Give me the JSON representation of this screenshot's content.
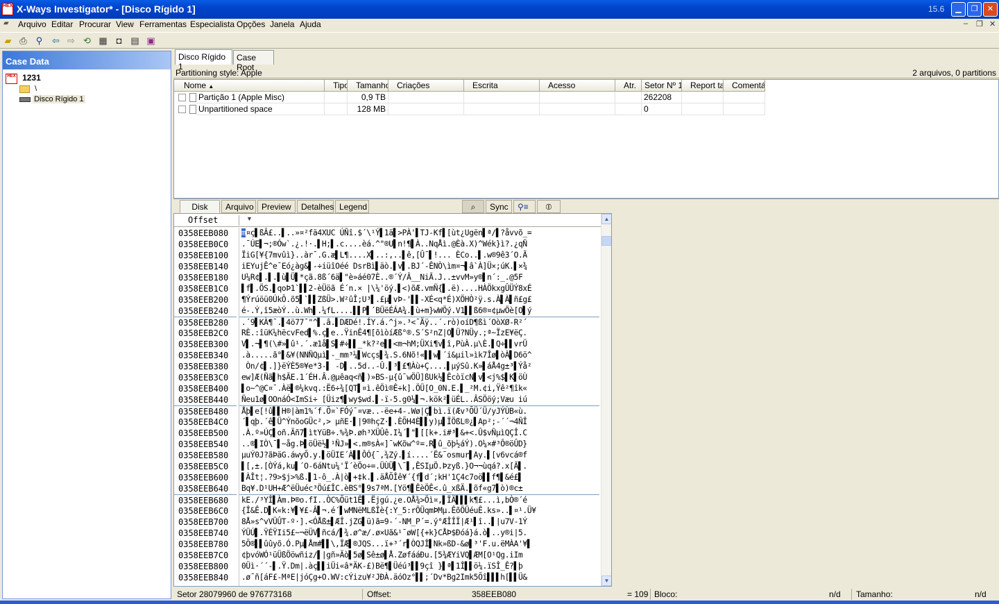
{
  "window": {
    "title": "X-Ways Investigator* - [Disco Rígido 1]",
    "version": "15.6",
    "app_icon_text": "HEX"
  },
  "menu": [
    "Arquivo",
    "Editar",
    "Procurar",
    "View",
    "Ferramentas",
    "Especialista",
    "Opções",
    "Janela",
    "Ajuda"
  ],
  "toolbar_icons": [
    "open-folder-icon",
    "print-icon",
    "binoculars-icon",
    "back-arrow-icon",
    "forward-arrow-icon",
    "refresh-icon",
    "calculator-icon",
    "camera-icon",
    "table-icon",
    "book-icon"
  ],
  "case": {
    "header": "Case Data",
    "name": "1231",
    "root_folder": "\\",
    "disk": "Disco Rígido 1"
  },
  "tabs": [
    "Disco Rígido 1",
    "Case Root"
  ],
  "partitioning_style": "Partitioning style: Apple",
  "summary": "2 arquivos, 0 partitions",
  "columns": [
    "Nome",
    "Tipo",
    "Tamanho",
    "Criações",
    "Escrita",
    "Acesso",
    "Atr.",
    "Setor Nº 1",
    "Report tal",
    "Comentário"
  ],
  "files": [
    {
      "name": "Partição 1 (Apple Misc)",
      "tipo": "",
      "tamanho": "0,9 TB",
      "sector": "262208"
    },
    {
      "name": "Unpartitioned space",
      "tipo": "",
      "tamanho": "128 MB",
      "sector": "0"
    }
  ],
  "bottom_tabs": [
    "Disk",
    "Arquivo",
    "Preview",
    "Detalhes",
    "Legend"
  ],
  "sync_label": "Sync",
  "hex": {
    "offset_label": "Offset",
    "offsets": [
      "0358EEB080",
      "0358EEB0C0",
      "0358EEB100",
      "0358EEB140",
      "0358EEB180",
      "0358EEB1C0",
      "0358EEB200",
      "0358EEB240",
      "0358EEB280",
      "0358EEB2C0",
      "0358EEB300",
      "0358EEB340",
      "0358EEB380",
      "0358EEB3C0",
      "0358EEB400",
      "0358EEB440",
      "0358EEB480",
      "0358EEB4C0",
      "0358EEB500",
      "0358EEB540",
      "0358EEB580",
      "0358EEB5C0",
      "0358EEB600",
      "0358EEB640",
      "0358EEB680",
      "0358EEB6C0",
      "0358EEB700",
      "0358EEB740",
      "0358EEB780",
      "0358EEB7C0",
      "0358EEB800",
      "0358EEB840"
    ],
    "lines": [
      "m¤ç▌ßÂ£..▌..»¤²fä4XUC ÚÑî.$´\\¹Ý▌1ä▌>PÀ'▌TJ-Kf▌[ùt¿Ugën▌ª/▌?åvvõ_=",
      ".¯ÚE▌¬;®Ów`.¿.!·.▌H;▌.c....èá.^\"®U▌n!¶▌À..NqÅì.@Èà.X)^Wék}ì?.¿qÑ",
      "ÏiG[¥{7mvûì}..àr¯.G.æ▌L¶....X▌..:,..▌ê,[Û¯▌!... ÈCo..▌.w®9ê3´O.Ã",
      "iEYujÊ^e¯Eó¿àg&▌-÷iüîOéé DsrBì▌äò.▌v▌.BJ´-ÊNÒ\\ìm¤¬▌â`À]Ü×;úK.▌×¾",
      "U¼R¢▌.▌.▌ù▌Ü▌*çã.8ß´6ä▌\"è»áé07È..®´Ý/Â__NiÃ.J..±vvM»y®▌n´:_.@5F",
      "▌f▌.ÖS.▌qoÞ1`▌▌2-èÜöã É´n.× |\\¼'öý.▌<)õÆ.vmÑ{▌.ë)....HÀÖkxgÛÜÝ8xÉ",
      "¶Ýrúöü0ÚkÔ.õ5▌`▌▌ZßÜ>.W²ûÎ;U³▌.£µ▌vÞ-'▌▌-XÉ<q*É)XÖHÒ²ÿ.s.À▌À▌ñ£g£",
      "é-.Ý,î5æòÝ..ù.Wh▌.¼fL....▌▌P▌´BÜëÉÁA¾.▌ù+m}wWÖý.V1▌▌ß6®¤¢µwÖè[O▌ý",
      ".´9▌KÀ¶¯.▌4ö77¯\"^▌.â.▌DÆDé!.ÍY.á.^j».³<¯Äÿ..´.rò)oíD¶ßì´OòXØ-R²´",
      "RÈ.:îüK¼hëcvFed▌%.ç▌e..ŸinÊ4¶[õìòíÆß°®.S´S²nZ|O▌Ü?NÜy.;ª~ÏzE¥ëÇ.",
      "V▌.¬▌¶(\\#»▌û¹.´.æ1å▌S▌#÷▌▌_*k?²e▌▌<m¬hM;ÜXi¶v▌î,PùÀ.µ\\È.▌Q÷▌▌vrÜ",
      ".à.....ã°▌&¥(NNÑQµì▌-_mm³¼▌Wcçs▌¾.S.6Nõ!«▌▌w▌´i&µil»ìk7Îø▌òÀ▌D6ö^",
      " Òn/¢▌.]}ëÝÈ5®¥e*3-▌ -D▌..5d..-Û.▌³▌£¶Àù+Ç....▌µýSû.K»▌áÅ4g±³▌Ýå²",
      "ew]Æ(Ñã▌h$ÃE.1´ÉH.Â.@µêaq<ñ▌)»BS-µ{û¯wÖÜ]ßUk½▌ÊcòïcN▌v▌<j%$▌K▌öÙ",
      "▌o~^@C¤¯.Àë▌®¼kvq.:Ë6÷¾[QT▌¤ì.êÖì®Ê÷k].ÖÜ[O_0N.E.▌_²M.¢i,Ÿê²¶îk«",
      "Ñeu1ø▌OOnáÓ<ImSi÷ [Üiz¶▌wy$wd.▌-ï-5.g0¼▌¬.kök²▌üÉL..ÂSÖöý;Væu iú",
      "Åþ▌e[!û▌▌H®|àm1%´f.Õ¤`FÓý¯¤væ..-ëe+4-.Wø|Ç▌bì.ï(Æv³ÕÜ´Ü/yJÝÙB«ù.",
      "´▌qþ.´ê▌Ü^ÝnõoGÜc²,> µñE·▌|9®hçZ·▌.ÈÕH4È▌▌y)µ▌ÏÖßL®¿▌Ap²;-´´¬4ÑÎ",
      ".À.º»ÚÇ▌oñ.Äñ7▌ìtYüB÷.%¾Þ.øh³XÜÛê.I¼´▌\"▌[[k+.i#³▌&+<.Û$vÑµìQÇÎ.C",
      "..®▌IÒ\\¯▌~åg.Þ▌öÜë½▌¹ÑJ»▌<.m®sÀ«]¯wKõw^º=.R▌û_õþ½áÝ).O¼×#³Ô®öÛD}",
      "µuÝ0J?ãÞäG.áwyÕ.y.▌öÜIE´À▌▌ÔÓ{¯,¾Zý.▌í....´Ë&¯osmur▌Ay.▌[v6vcá®f",
      "▌[,±.[ÒÝá,ku▌´O-6áNtu¼'Ï´èÖo÷=.ÜÙÜ▌\\¯▌,ÊSIµÖ.Þzyß.}O¬¬ùqá?.x[Ã▌.",
      "▌ÀÎt¦.?9>$j>%ß.▌1-ô_.À|ò▌+‡k.▌.äÅÕÎê¥´{f▌d´;kH'1Ç4c7oö▌▌f¶▌&é£▌",
      "Bq¥.D¹UH+Æ^ëÜuéc³Öú£ÎC.èBS°▌9s7ªM.[Yö¶▌ÊèÖÊ<.û_xßÄ.▌õf«g7▌ò)®c±",
      "kE./³YÎ▌Àm.Þ®o.fI..ÒC%Õüt1Ê▌.Ëjgú.¿e.OÅ¾>Öì¤,▌ÏÄ▌▌▌k¶£...ì,bÒ®´é",
      "{Î&Ê.D▌K«k:¥▌¥£-Â▌¬.é´▌wMNëMLßÎè{:Y_5:rÖÜqmÞMµ.ÊõÖÜéuÊ.ks»..▌¤¹.Ü¥",
      "8Å»s^vVÜÛT-º·].<ÓÅß±▌ÆÎ.jZG▌ü)ã=9-´-NM_P´=.ý°ÆÎÎÏ|Æ¹▌î..▌|u7V-1Ý",
      "ÝÜÚ▌.ŸÉŸIi5£~¬ëÜV▌ñcá/▌¾.ø^æ/.ø×Uã&¹¯øW[{+k}CÅÞ$Ðóá}á.ò▌..y®i|5.",
      "5Õ®▌▌ûûyõ.Ó.Pµ▌Åm#▌▌\\,ÏÆ▌®JQS...ï+³´r▌ÒQJÎ▌Nk»ßD-&ø▌³'F.u.ëMÀA'¥▌",
      "¢þvóWÓ¹üÜßÖöwñiz/▌|gñ»Äò▌5ø▌Sê±ø▌Å.ZøfááÐu.[5¾ÆYiVQ▌ÆM[O¹Qg.iIm",
      "0Üì·´´-▌.Ÿ.Dm|.àç▌▌iÜi«â*ÄK-£)Bë¶▌Üéú³▌▌9çî }▌ª▌1Î▌▌ö¼.ïSÎ_Ê?▌þ",
      ".ø¯ñ[áF£-MªE|jóÇg+O.WV:cÝizu¥²JÐÀ.äóOz°▌▌;´Dv*Bg2Imk5Õî▌▌▌h[▌▌Ü&"
    ]
  },
  "status": {
    "sector": "Setor 28079960 de 976773168",
    "offset_label": "Offset:",
    "offset_value": "358EEB080",
    "eq": "= 109",
    "bloco_label": "Bloco:",
    "bloco_value": "n/d",
    "tamanho_label": "Tamanho:",
    "tamanho_value": "n/d"
  },
  "colors": {
    "titlebar": "#0054e3",
    "selection": "#316ac5",
    "accent": "#3c78d8"
  }
}
